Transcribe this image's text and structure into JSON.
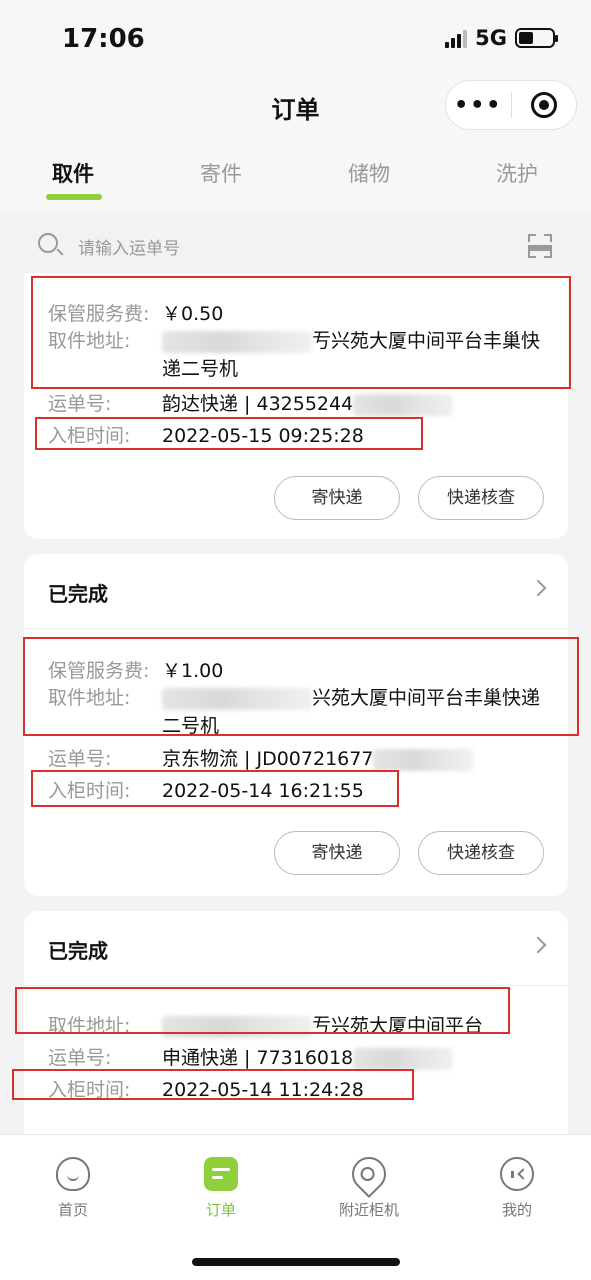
{
  "status_bar": {
    "time": "17:06",
    "network": "5G"
  },
  "nav": {
    "title": "订单",
    "more": "•••"
  },
  "tabs": [
    {
      "label": "取件",
      "active": true
    },
    {
      "label": "寄件",
      "active": false
    },
    {
      "label": "储物",
      "active": false
    },
    {
      "label": "洗护",
      "active": false
    }
  ],
  "search": {
    "placeholder": "请输入运单号"
  },
  "labels": {
    "fee": "保管服务费:",
    "address": "取件地址:",
    "waybill": "运单号:",
    "time": "入柜时间:"
  },
  "orders": [
    {
      "status": "",
      "fee": "￥0.50",
      "address": "亐兴苑大厦中间平台丰巢快递二号机",
      "waybill": "韵达快递 | 43255244",
      "time": "2022-05-15 09:25:28",
      "buttons": [
        "寄快递",
        "快递核查"
      ]
    },
    {
      "status": "已完成",
      "fee": "￥1.00",
      "address": "兴苑大厦中间平台丰巢快递二号机",
      "waybill": "京东物流 | JD00721677",
      "time": "2022-05-14 16:21:55",
      "buttons": [
        "寄快递",
        "快递核查"
      ]
    },
    {
      "status": "已完成",
      "address": "亐兴苑大厦中间平台",
      "waybill": "申通快递 | 77316018",
      "time": "2022-05-14 11:24:28"
    }
  ],
  "tabbar": [
    {
      "label": "首页",
      "icon": "home-face-icon"
    },
    {
      "label": "订单",
      "icon": "order-list-icon",
      "active": true
    },
    {
      "label": "附近柜机",
      "icon": "location-pin-icon"
    },
    {
      "label": "我的",
      "icon": "profile-icon"
    }
  ],
  "colors": {
    "accent": "#8fcf3c",
    "highlight_box": "#d9302f"
  }
}
